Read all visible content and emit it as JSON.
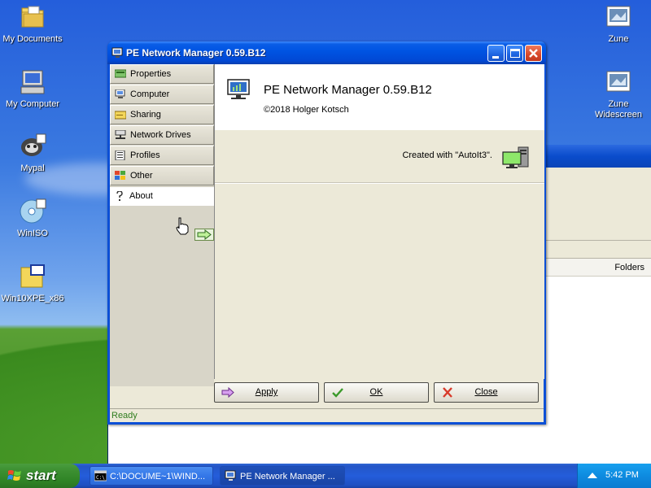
{
  "desktop": {
    "icons": [
      {
        "label": "My Documents",
        "icon": "folder-documents-icon"
      },
      {
        "label": "My Computer",
        "icon": "computer-icon"
      },
      {
        "label": "Mypal",
        "icon": "mypal-browser-icon"
      },
      {
        "label": "WinISO",
        "icon": "disc-icon"
      },
      {
        "label": "Win10XPE_x86",
        "icon": "iso-file-icon"
      },
      {
        "label": "Zune",
        "icon": "picture-file-icon"
      },
      {
        "label": "Zune Widescreen",
        "icon": "picture-file-icon"
      }
    ],
    "bg_window": {
      "folders_label": "Folders"
    }
  },
  "window": {
    "title": "PE Network Manager 0.59.B12",
    "sidebar": {
      "items": [
        {
          "label": "Properties",
          "icon": "network-card-icon",
          "active": false
        },
        {
          "label": "Computer",
          "icon": "monitor-icon",
          "active": false
        },
        {
          "label": "Sharing",
          "icon": "folder-share-icon",
          "active": false
        },
        {
          "label": "Network Drives",
          "icon": "network-drive-icon",
          "active": false
        },
        {
          "label": "Profiles",
          "icon": "profile-list-icon",
          "active": false
        },
        {
          "label": "Other",
          "icon": "windows-grid-icon",
          "active": false
        },
        {
          "label": "About",
          "icon": "help-question-icon",
          "active": true
        }
      ]
    },
    "about": {
      "app_name": "PE Network Manager 0.59.B12",
      "copyright": "©2018 Holger Kotsch",
      "created_with": "Created with \"AutoIt3\"."
    },
    "buttons": {
      "apply": "Apply",
      "ok": "OK",
      "close": "Close"
    },
    "status": "Ready",
    "colors": {
      "status_text": "#2f7d1e",
      "titlebar": "#0054e3"
    }
  },
  "taskbar": {
    "start_label": "start",
    "tasks": [
      {
        "label": "C:\\DOCUME~1\\WIND...",
        "icon": "console-icon",
        "active": false
      },
      {
        "label": "PE Network Manager ...",
        "icon": "network-manager-icon",
        "active": true
      }
    ],
    "clock": "5:42 PM"
  }
}
